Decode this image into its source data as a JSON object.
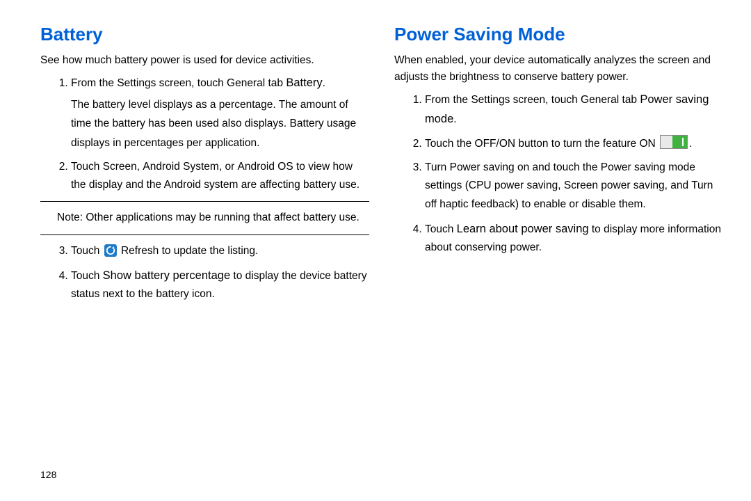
{
  "page_number": "128",
  "left": {
    "heading": "Battery",
    "intro": "See how much battery power is used for device activities.",
    "step1_prefix": "From the ",
    "step1_settings": "Settings",
    "step1_mid": " screen, touch ",
    "step1_general": "General",
    "step1_tab": " tab",
    "step1_arrow": " ",
    "step1_battery": "Battery",
    "step1_period": ".",
    "step1_detail": "The battery level displays as a percentage. The amount of time the battery has been used also displays. Battery usage displays in percentages per application.",
    "step2_prefix": "Touch ",
    "step2_a": "Screen",
    "step2_sep1": ", ",
    "step2_b": "Android System",
    "step2_sep2": ", or ",
    "step2_c": "Android OS",
    "step2_suffix": " to view how the display and the Android system are affecting battery use.",
    "note_label": "Note:",
    "note_text": " Other applications may be running that affect battery use.",
    "step3_prefix": "Touch ",
    "step3_refresh": " Refresh",
    "step3_suffix": " to update the listing.",
    "step4_prefix": "Touch ",
    "step4_opt": "Show battery percentage",
    "step4_suffix": " to display the device battery status next to the battery icon."
  },
  "right": {
    "heading": "Power Saving Mode",
    "intro": "When enabled, your device automatically analyzes the screen and adjusts the brightness to conserve battery power.",
    "step1_prefix": "From the ",
    "step1_settings": "Settings",
    "step1_mid": " screen, touch ",
    "step1_general": "General",
    "step1_tab": " tab",
    "step1_arrow": " ",
    "step1_psm": "Power saving mode",
    "step1_period": ".",
    "step2_prefix": "Touch the ",
    "step2_offon": "OFF/ON",
    "step2_mid": " button to turn the feature ",
    "step2_on": "ON",
    "step2_period": ".",
    "step3": "Turn Power saving on and touch the Power saving mode settings (CPU power saving, Screen power saving, and Turn off haptic feedback) to enable or disable them.",
    "step4_prefix": "Touch ",
    "step4_opt": "Learn about power saving",
    "step4_suffix": " to display more information about conserving power."
  }
}
